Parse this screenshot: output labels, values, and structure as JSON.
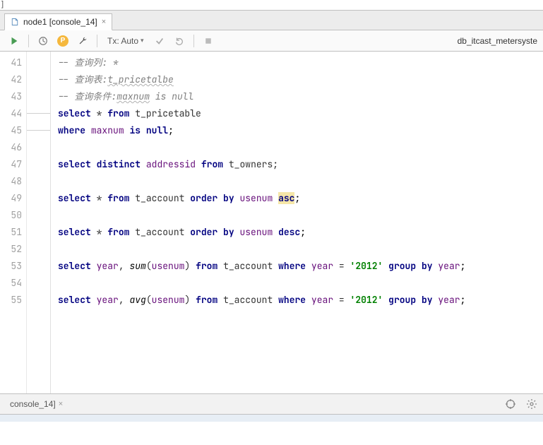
{
  "tab": {
    "title": "node1 [console_14]"
  },
  "toolbar": {
    "tx_label": "Tx: Auto",
    "db_label": "db_itcast_metersyste"
  },
  "gutter": [
    "41",
    "42",
    "43",
    "44",
    "45",
    "46",
    "47",
    "48",
    "49",
    "50",
    "51",
    "52",
    "53",
    "54",
    "55"
  ],
  "code": {
    "l41_a": "-- 查询列: *",
    "l42_a": "-- 查询表:",
    "l42_b": "t_pricetalbe",
    "l43_a": "-- 查询条件:",
    "l43_b": "maxnum",
    "l43_c": " is null",
    "l44_a": "select",
    "l44_b": " * ",
    "l44_c": "from",
    "l44_d": " t_pricetable",
    "l45_a": "where",
    "l45_b": " ",
    "l45_c": "maxnum",
    "l45_d": " ",
    "l45_e": "is null",
    "l45_f": ";",
    "l47_a": "select",
    "l47_b": " ",
    "l47_c": "distinct",
    "l47_d": " ",
    "l47_e": "addressid",
    "l47_f": " ",
    "l47_g": "from",
    "l47_h": " t_owners;",
    "l49_a": "select",
    "l49_b": " * ",
    "l49_c": "from",
    "l49_d": " t_account ",
    "l49_e": "order by",
    "l49_f": " ",
    "l49_g": "usenum",
    "l49_h": " ",
    "l49_i": "asc",
    "l49_j": ";",
    "l51_a": "select",
    "l51_b": " * ",
    "l51_c": "from",
    "l51_d": " t_account ",
    "l51_e": "order by",
    "l51_f": " ",
    "l51_g": "usenum",
    "l51_h": " ",
    "l51_i": "desc",
    "l51_j": ";",
    "l53_a": "select",
    "l53_b": " ",
    "l53_c": "year",
    "l53_d": ", ",
    "l53_e": "sum",
    "l53_f": "(",
    "l53_g": "usenum",
    "l53_h": ") ",
    "l53_i": "from",
    "l53_j": " t_account ",
    "l53_k": "where",
    "l53_l": " ",
    "l53_m": "year",
    "l53_n": " = ",
    "l53_o": "'2012'",
    "l53_p": " ",
    "l53_q": "group by",
    "l53_r": " ",
    "l53_s": "year",
    "l53_t": ";",
    "l55_a": "select",
    "l55_b": " ",
    "l55_c": "year",
    "l55_d": ", ",
    "l55_e": "avg",
    "l55_f": "(",
    "l55_g": "usenum",
    "l55_h": ") ",
    "l55_i": "from",
    "l55_j": " t_account ",
    "l55_k": "where",
    "l55_l": " ",
    "l55_m": "year",
    "l55_n": " = ",
    "l55_o": "'2012'",
    "l55_p": " ",
    "l55_q": "group by",
    "l55_r": " ",
    "l55_s": "year",
    "l55_t": ";"
  },
  "footer": {
    "tab_label": "console_14]"
  }
}
